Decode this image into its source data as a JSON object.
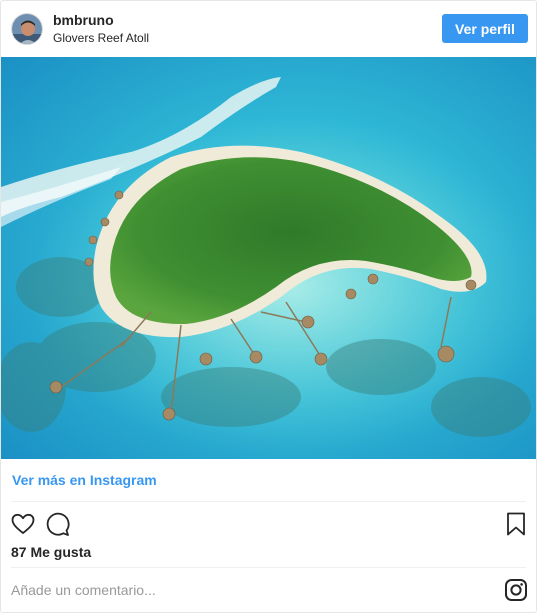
{
  "header": {
    "username": "bmbruno",
    "location": "Glovers Reef Atoll",
    "view_profile_label": "Ver perfil",
    "avatar_icon": "user-avatar"
  },
  "post": {
    "image_subject": "aerial-island-photo",
    "more_link": "Ver más en Instagram",
    "likes_text": "87 Me gusta"
  },
  "actions": {
    "like_icon": "heart-icon",
    "comment_icon": "speech-bubble-icon",
    "save_icon": "bookmark-icon"
  },
  "comment": {
    "placeholder": "Añade un comentario...",
    "instagram_icon": "instagram-logo-icon"
  },
  "colors": {
    "accent": "#3897f0",
    "text": "#262626",
    "border": "#e6e6e6",
    "placeholder": "#999999"
  }
}
